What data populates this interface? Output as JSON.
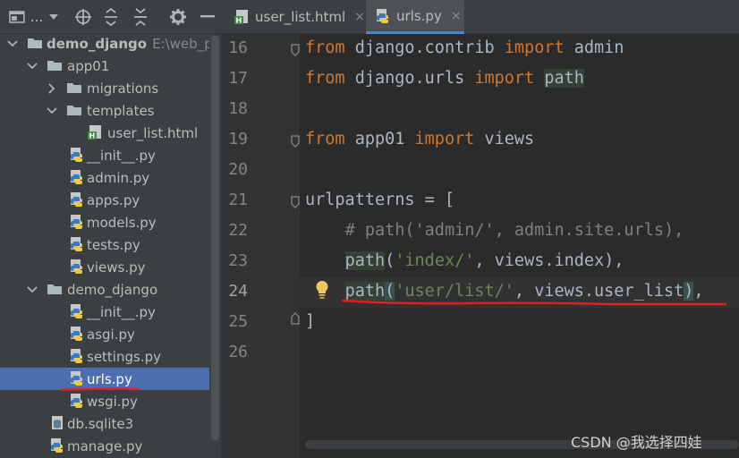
{
  "toolbar": {
    "project_dropdown_label": "...",
    "icons": [
      "project-view-icon",
      "locate-target-icon",
      "expand-all-icon",
      "collapse-all-icon",
      "gear-icon",
      "hide-panel-icon"
    ]
  },
  "project_tree": {
    "root": {
      "name": "demo_django",
      "path": "E:\\web_pro"
    },
    "app01": {
      "name": "app01",
      "migrations": "migrations",
      "templates": "templates",
      "user_list_html": "user_list.html",
      "init": "__init__.py",
      "admin": "admin.py",
      "apps": "apps.py",
      "models": "models.py",
      "tests": "tests.py",
      "views": "views.py"
    },
    "demo_django": {
      "name": "demo_django",
      "init": "__init__.py",
      "asgi": "asgi.py",
      "settings": "settings.py",
      "urls": "urls.py",
      "wsgi": "wsgi.py"
    },
    "db": "db.sqlite3",
    "manage": "manage.py",
    "selected": "urls.py"
  },
  "tabs": [
    {
      "label": "user_list.html",
      "close": "×",
      "active": false
    },
    {
      "label": "urls.py",
      "close": "×",
      "active": true
    }
  ],
  "editor": {
    "line_numbers": [
      "16",
      "17",
      "18",
      "19",
      "20",
      "21",
      "22",
      "23",
      "24",
      "25",
      "26"
    ],
    "current_line": "24",
    "code": {
      "l16_from": "from",
      "l16_mod": " django.contrib ",
      "l16_import": "import",
      "l16_name": " admin",
      "l17_from": "from",
      "l17_mod": " django.urls ",
      "l17_import": "import",
      "l17_sp": " ",
      "l17_name": "path",
      "l19_from": "from",
      "l19_mod": " app01 ",
      "l19_import": "import",
      "l19_name": " views",
      "l21": "urlpatterns = [",
      "l22_indent": "    ",
      "l22_comment": "# path('admin/', admin.site.urls),",
      "l23_indent": "    ",
      "l23_fn": "path",
      "l23_p": "(",
      "l23_str": "'index/'",
      "l23_rest": ", views.index),",
      "l24_indent": "    ",
      "l24_fn": "path",
      "l24_p": "(",
      "l24_str": "'user/list/'",
      "l24_rest": ", views.user_list",
      "l24_close": ")",
      "l24_comma": ",",
      "l25": "]"
    }
  },
  "watermark": "CSDN @我选择四娃",
  "colors": {
    "keyword": "#cc7832",
    "string": "#6a8759",
    "comment": "#808080",
    "text": "#a9b7c6",
    "selection": "#4b6eaf",
    "annotation_underline": "#e02020"
  }
}
